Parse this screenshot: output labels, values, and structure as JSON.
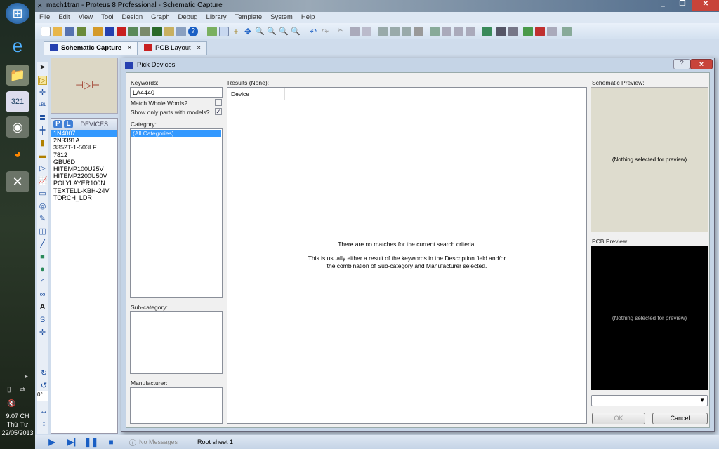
{
  "window": {
    "title": "mach1tran - Proteus 8 Professional - Schematic Capture"
  },
  "menu": [
    "File",
    "Edit",
    "View",
    "Tool",
    "Design",
    "Graph",
    "Debug",
    "Library",
    "Template",
    "System",
    "Help"
  ],
  "tabs": [
    {
      "label": "Schematic Capture",
      "close": "×",
      "active": true
    },
    {
      "label": "PCB Layout",
      "close": "×",
      "active": false
    }
  ],
  "devices_panel": {
    "header": "DEVICES",
    "p_button": "P",
    "l_button": "L",
    "items": [
      "1N4007",
      "2N3391A",
      "3352T-1-503LF",
      "7812",
      "GBU6D",
      "HITEMP100U25V",
      "HITEMP2200U50V",
      "POLYLAYER100N",
      "TEXTELL-KBH-24V",
      "TORCH_LDR"
    ],
    "selected": "1N4007"
  },
  "rotation": "0°",
  "dialog": {
    "title": "Pick Devices",
    "help_button": "?",
    "close_button": "×",
    "keywords_label": "Keywords:",
    "keywords_value": "LA4440",
    "match_whole_words": {
      "label": "Match Whole Words?",
      "checked": false
    },
    "only_models": {
      "label": "Show only parts with models?",
      "checked": true,
      "mark": "✓"
    },
    "category_label": "Category:",
    "categories": [
      "(All Categories)"
    ],
    "subcategory_label": "Sub-category:",
    "manufacturer_label": "Manufacturer:",
    "results_label": "Results (None):",
    "results_columns": [
      "Device"
    ],
    "no_match_line1": "There are no matches for the current search criteria.",
    "no_match_line2": "This is usually either a result of the keywords in the Description field and/or",
    "no_match_line3": "the combination of Sub-category and Manufacturer selected.",
    "schematic_preview_label": "Schematic Preview:",
    "schematic_preview_text": "(Nothing selected for preview)",
    "pcb_preview_label": "PCB Preview:",
    "pcb_preview_text": "(Nothing selected for preview)",
    "ok_button": "OK",
    "cancel_button": "Cancel"
  },
  "statusbar": {
    "messages": "No Messages",
    "sheet": "Root sheet 1"
  },
  "system_tray": {
    "time": "9:07 CH",
    "day": "Thứ Tư",
    "date": "22/05/2013"
  }
}
